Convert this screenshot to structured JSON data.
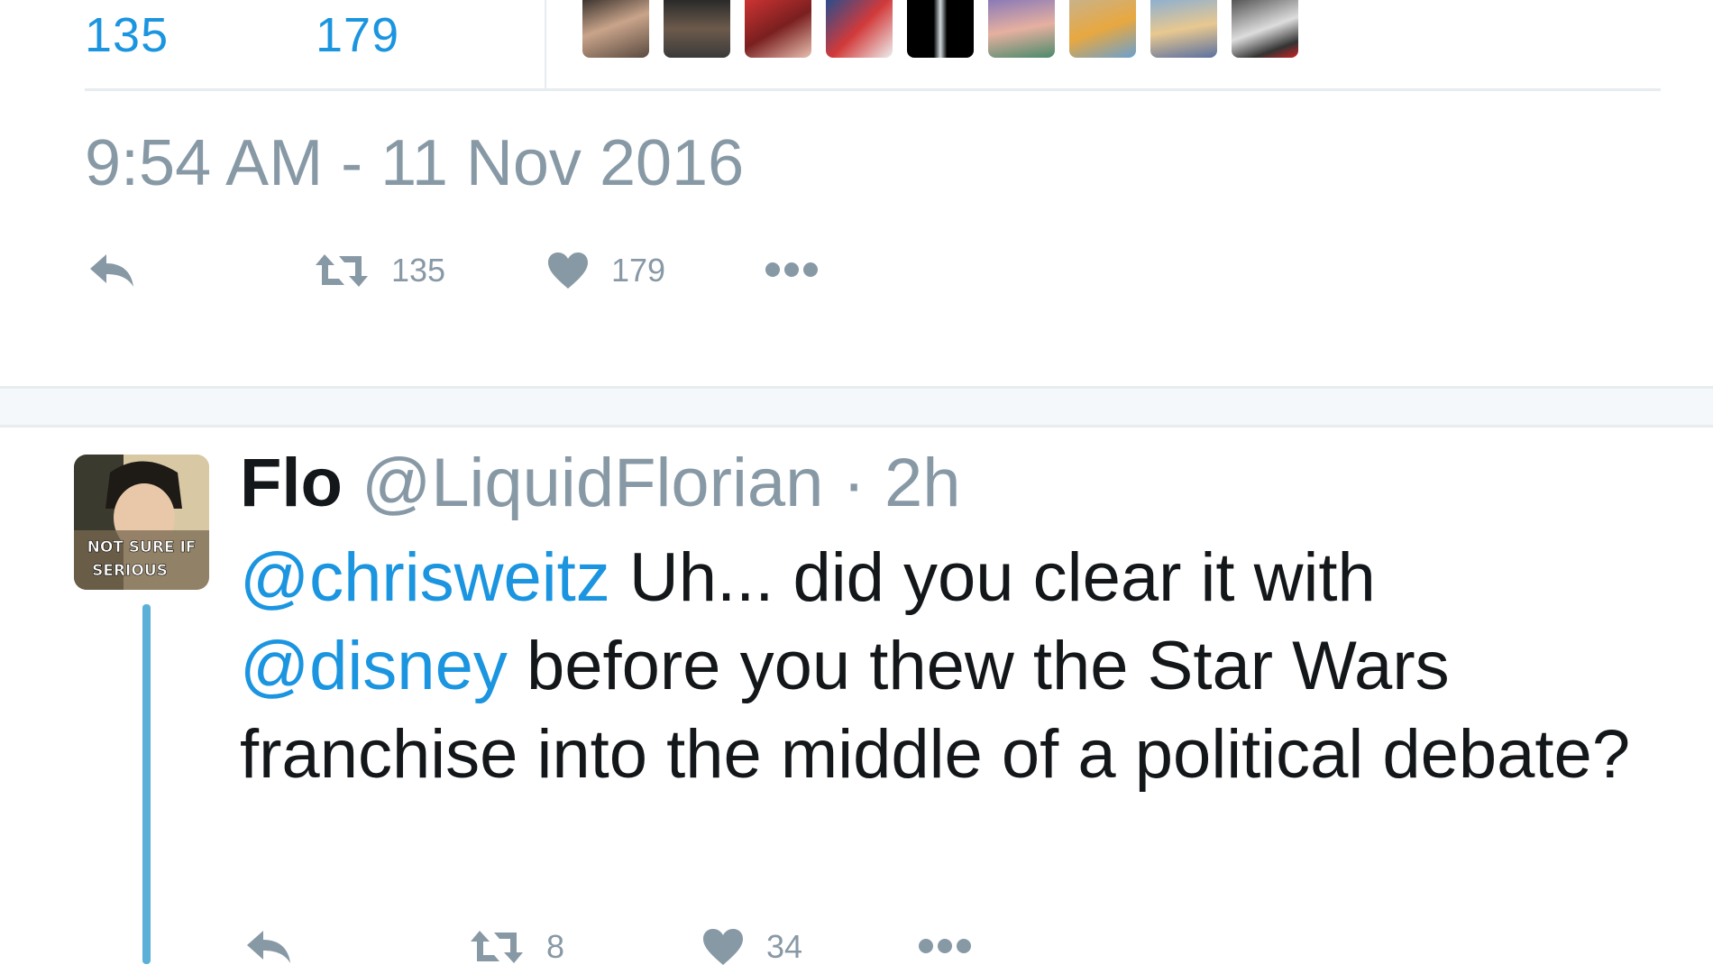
{
  "top_tweet": {
    "retweets_count": "135",
    "likes_count": "179",
    "liker_avatars": [
      "avatar-1",
      "avatar-2",
      "avatar-3",
      "avatar-4",
      "avatar-5",
      "avatar-6",
      "avatar-7",
      "avatar-8",
      "avatar-9"
    ],
    "timestamp": "9:54 AM - 11 Nov 2016",
    "actions": {
      "reply_icon": "reply-icon",
      "retweet_count": "135",
      "like_count": "179",
      "more_icon": "more-icon"
    }
  },
  "reply_tweet": {
    "avatar_caption_line1": "NOT SURE IF",
    "avatar_caption_line2": "SERIOUS",
    "display_name": "Flo",
    "handle": "@LiquidFlorian",
    "separator": "·",
    "time_ago": "2h",
    "text_parts": {
      "mention1": "@chrisweitz",
      "text1": " Uh... did you clear it with ",
      "mention2": "@disney",
      "text2": " before you thew the Star Wars franchise into the middle of a political debate?"
    },
    "actions": {
      "retweet_count": "8",
      "like_count": "34"
    }
  },
  "colors": {
    "accent": "#1b95e0",
    "muted": "#8899a6",
    "text": "#14171a",
    "thread_line": "#5bb0d9"
  }
}
